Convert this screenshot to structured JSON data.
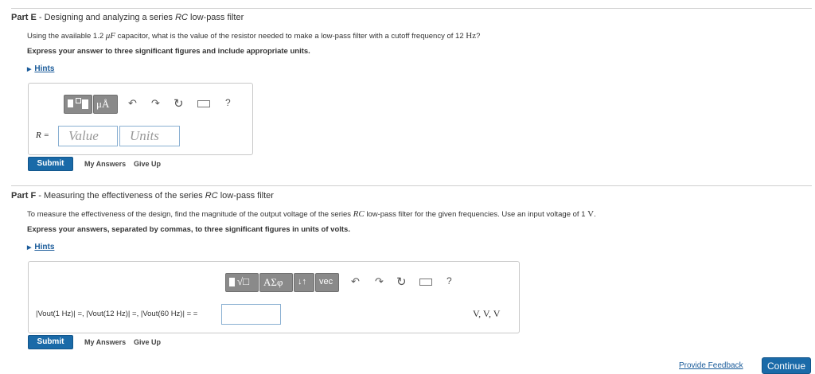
{
  "partE": {
    "label": "Part E",
    "sep": " - ",
    "title_pre": "Designing and analyzing a series ",
    "title_rc": "RC",
    "title_post": " low-pass filter",
    "question_a": "Using the available 1.2 ",
    "question_unit_mu": "μF",
    "question_b": " capacitor, what is the value of the resistor needed to make a low-pass filter with a cutoff frequency of 12 ",
    "question_hz": "Hz",
    "question_c": "?",
    "instruction": "Express your answer to three significant figures and include appropriate units.",
    "hints": "Hints",
    "toolbar": {
      "units_symbol": "μÅ",
      "help": "?"
    },
    "input_label": "R =",
    "value_placeholder": "Value",
    "units_placeholder": "Units",
    "submit": "Submit",
    "my_answers": "My Answers",
    "give_up": "Give Up"
  },
  "partF": {
    "label": "Part F",
    "sep": " - ",
    "title_pre": "Measuring the effectiveness of the series ",
    "title_rc": "RC",
    "title_post": " low-pass filter",
    "question_a": "To measure the effectiveness of the design, find the magnitude of the output voltage of the series ",
    "question_rc": "RC",
    "question_b": " low-pass filter for the given frequencies. Use an input voltage of 1 ",
    "question_v": "V",
    "question_c": ".",
    "instruction": "Express your answers, separated by commas, to three significant figures in units of volts.",
    "hints": "Hints",
    "toolbar": {
      "greek": "ΑΣφ",
      "arrows": "↓↑",
      "vec": "vec",
      "help": "?"
    },
    "input_label": "|Vout(1 Hz)| =, |Vout(12 Hz)| =, |Vout(60 Hz)| = =",
    "units_suffix": "V, V, V",
    "submit": "Submit",
    "my_answers": "My Answers",
    "give_up": "Give Up"
  },
  "footer": {
    "feedback": "Provide Feedback",
    "continue": "Continue"
  }
}
